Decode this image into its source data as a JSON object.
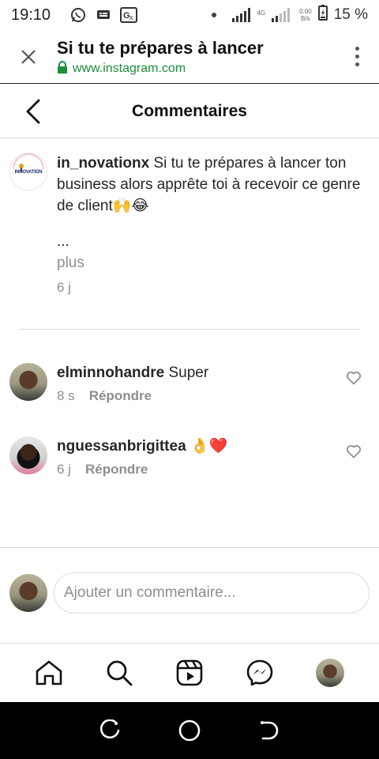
{
  "status_bar": {
    "time": "19:10",
    "network_label": "4G",
    "speed_value": "0.00",
    "speed_unit": "B/s",
    "battery": "15 %"
  },
  "browser": {
    "title": "Si tu te prépares à lancer",
    "url": "www.instagram.com"
  },
  "header": {
    "title": "Commentaires"
  },
  "caption": {
    "username": "in_novationx",
    "text": "Si tu te prépares à lancer ton business alors apprête toi à recevoir ce genre de client🙌😂",
    "ellipsis": "...",
    "more": "plus",
    "time": "6 j",
    "logo_text": "INNOVATION"
  },
  "comments": [
    {
      "username": "elminnohandre",
      "text": "Super",
      "time": "8 s",
      "reply": "Répondre"
    },
    {
      "username": "nguessanbrigittea",
      "text": "👌❤️",
      "time": "6 j",
      "reply": "Répondre"
    }
  ],
  "add_comment": {
    "placeholder": "Ajouter un commentaire..."
  },
  "colors": {
    "accent_green": "#1a8f3c",
    "text_primary": "#262626",
    "text_secondary": "#8e8e8e",
    "divider": "#dbdbdb"
  },
  "icons": {
    "close": "close-icon",
    "menu": "kebab-menu-icon",
    "back": "chevron-left-icon",
    "lock": "lock-icon",
    "heart": "heart-outline-icon",
    "home": "home-icon",
    "search": "search-icon",
    "reels": "reels-icon",
    "messenger": "messenger-icon"
  }
}
